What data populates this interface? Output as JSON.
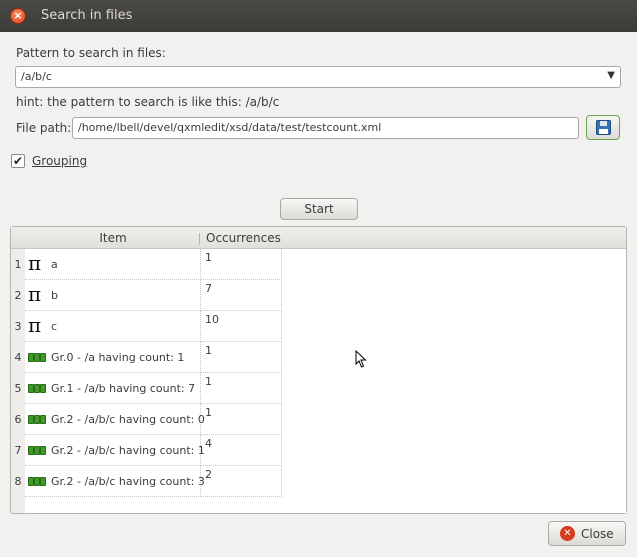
{
  "window": {
    "title": "Search in files"
  },
  "form": {
    "pattern_label": "Pattern to search in files:",
    "pattern_value": "/a/b/c",
    "hint": "hint: the pattern to search is like this: /a/b/c",
    "path_label": "File path:",
    "path_value": "/home/lbell/devel/qxmledit/xsd/data/test/testcount.xml",
    "grouping_label": "Grouping",
    "grouping_checked": true
  },
  "buttons": {
    "start": "Start",
    "close": "Close"
  },
  "table": {
    "columns": [
      "Item",
      "Occurrences"
    ],
    "rows": [
      {
        "num": "1",
        "icon": "pi-icon",
        "item": "a",
        "occ": "1"
      },
      {
        "num": "2",
        "icon": "pi-icon",
        "item": "b",
        "occ": "7"
      },
      {
        "num": "3",
        "icon": "pi-icon",
        "item": "c",
        "occ": "10"
      },
      {
        "num": "4",
        "icon": "group-icon",
        "item": "Gr.0 - /a having count: 1",
        "occ": "1"
      },
      {
        "num": "5",
        "icon": "group-icon",
        "item": "Gr.1 - /a/b having count: 7",
        "occ": "1"
      },
      {
        "num": "6",
        "icon": "group-icon",
        "item": "Gr.2 - /a/b/c having count: 0",
        "occ": "1"
      },
      {
        "num": "7",
        "icon": "group-icon",
        "item": "Gr.2 - /a/b/c having count: 1",
        "occ": "4"
      },
      {
        "num": "8",
        "icon": "group-icon",
        "item": "Gr.2 - /a/b/c having count: 3",
        "occ": "2"
      }
    ]
  }
}
